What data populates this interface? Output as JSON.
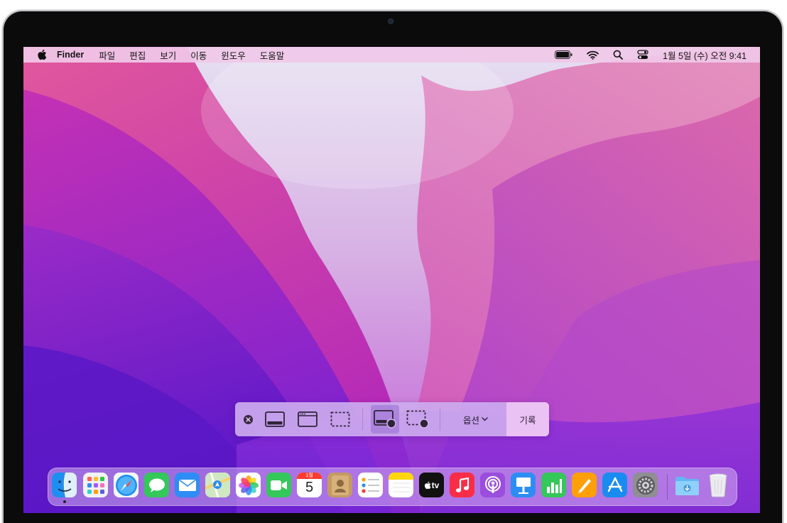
{
  "menubar": {
    "app_name": "Finder",
    "items": [
      "파일",
      "편집",
      "보기",
      "이동",
      "윈도우",
      "도움말"
    ],
    "status_icons": [
      "battery-icon",
      "wifi-icon",
      "spotlight-search-icon",
      "control-center-icon"
    ],
    "clock": "1월 5일 (수) 오전  9:41"
  },
  "toolbar": {
    "buttons": [
      "close-icon",
      "capture-entire-screen-icon",
      "capture-window-icon",
      "capture-selection-icon",
      "record-entire-screen-icon",
      "record-selection-icon"
    ],
    "active_button": "record-entire-screen-icon",
    "options_label": "옵션",
    "record_label": "기록"
  },
  "dock": {
    "apps": [
      "Finder",
      "Launchpad",
      "Safari",
      "Messages",
      "Mail",
      "Maps",
      "Photos",
      "FaceTime",
      "Calendar",
      "Contacts",
      "Reminders",
      "Notes",
      "TV",
      "Music",
      "Podcasts",
      "Keynote",
      "Numbers",
      "Pages",
      "App Store",
      "System Preferences"
    ],
    "calendar": {
      "month": "1월",
      "day": "5"
    },
    "tv_label": "tv",
    "trailing": [
      "Downloads",
      "Trash"
    ]
  },
  "colors": {
    "menubar_bg": "#f0c8e8",
    "wallpaper_top_left": "#d8349a",
    "wallpaper_bottom": "#6c1fd6",
    "wallpaper_center_light": "#ddd4f0",
    "toolbar_bg": "#ccaaee"
  }
}
